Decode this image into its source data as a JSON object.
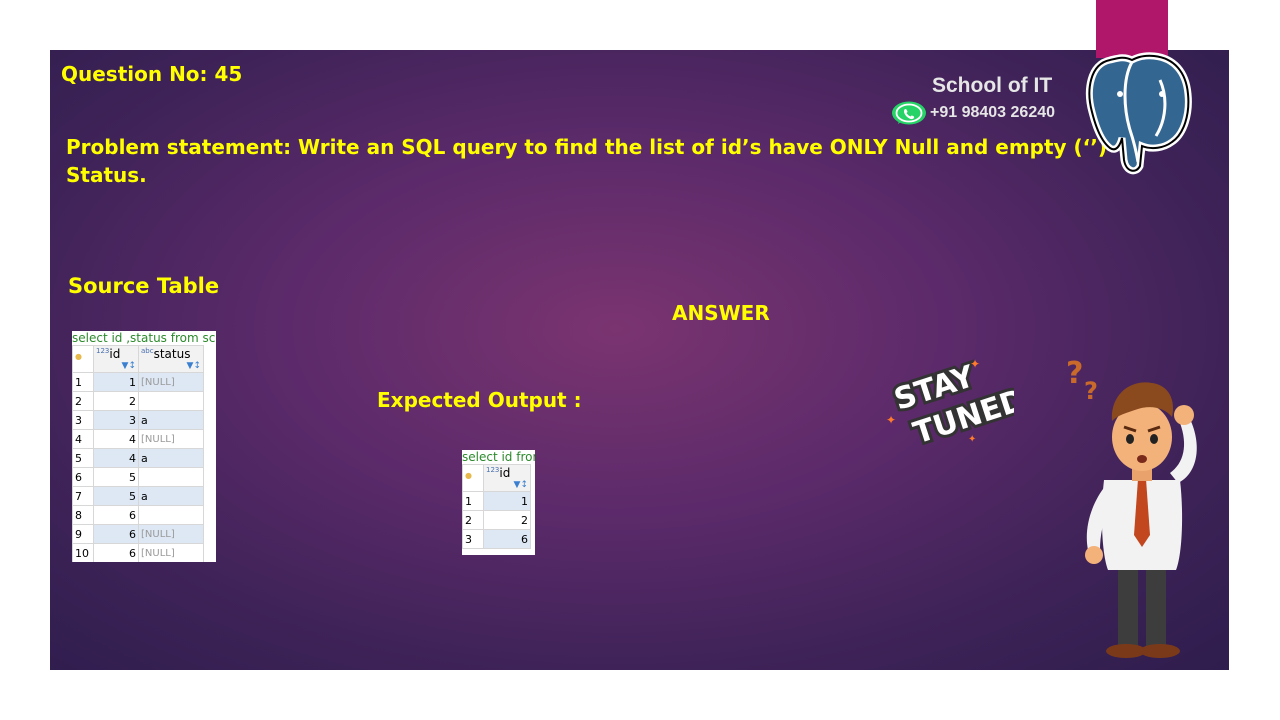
{
  "slide": {
    "question_no": "Question No: 45",
    "problem_statement": "Problem statement: Write an SQL query to find the list of id’s have ONLY Null and empty (‘’) Status.",
    "source_label": "Source Table",
    "answer_label": "ANSWER",
    "expected_label": "Expected  Output :",
    "brand": "School of IT",
    "phone": "+91 98403 26240",
    "sticker_line1": "STAY",
    "sticker_line2": "TUNED"
  },
  "source_table": {
    "query": "select id ,status from schoo",
    "columns": [
      "id",
      "status"
    ],
    "type_badges": [
      "123",
      "abc"
    ],
    "rows": [
      {
        "n": "1",
        "id": "1",
        "status": "[NULL]"
      },
      {
        "n": "2",
        "id": "2",
        "status": ""
      },
      {
        "n": "3",
        "id": "3",
        "status": "a"
      },
      {
        "n": "4",
        "id": "4",
        "status": "[NULL]"
      },
      {
        "n": "5",
        "id": "4",
        "status": "a"
      },
      {
        "n": "6",
        "id": "5",
        "status": ""
      },
      {
        "n": "7",
        "id": "5",
        "status": "a"
      },
      {
        "n": "8",
        "id": "6",
        "status": ""
      },
      {
        "n": "9",
        "id": "6",
        "status": "[NULL]"
      },
      {
        "n": "10",
        "id": "6",
        "status": "[NULL]"
      }
    ]
  },
  "output_table": {
    "query": "select id from",
    "columns": [
      "id"
    ],
    "type_badges": [
      "123"
    ],
    "rows": [
      {
        "n": "1",
        "id": "1"
      },
      {
        "n": "2",
        "id": "2"
      },
      {
        "n": "3",
        "id": "6"
      }
    ]
  },
  "colors": {
    "title_text": "#ffff00",
    "brand_text": "#e6e6e6",
    "accent_bar": "#b0166a",
    "elephant_blue": "#336791",
    "whatsapp_green": "#25d366"
  },
  "icons": [
    "whatsapp-icon",
    "postgresql-elephant-icon",
    "stay-tuned-sticker",
    "confused-man-illustration"
  ]
}
